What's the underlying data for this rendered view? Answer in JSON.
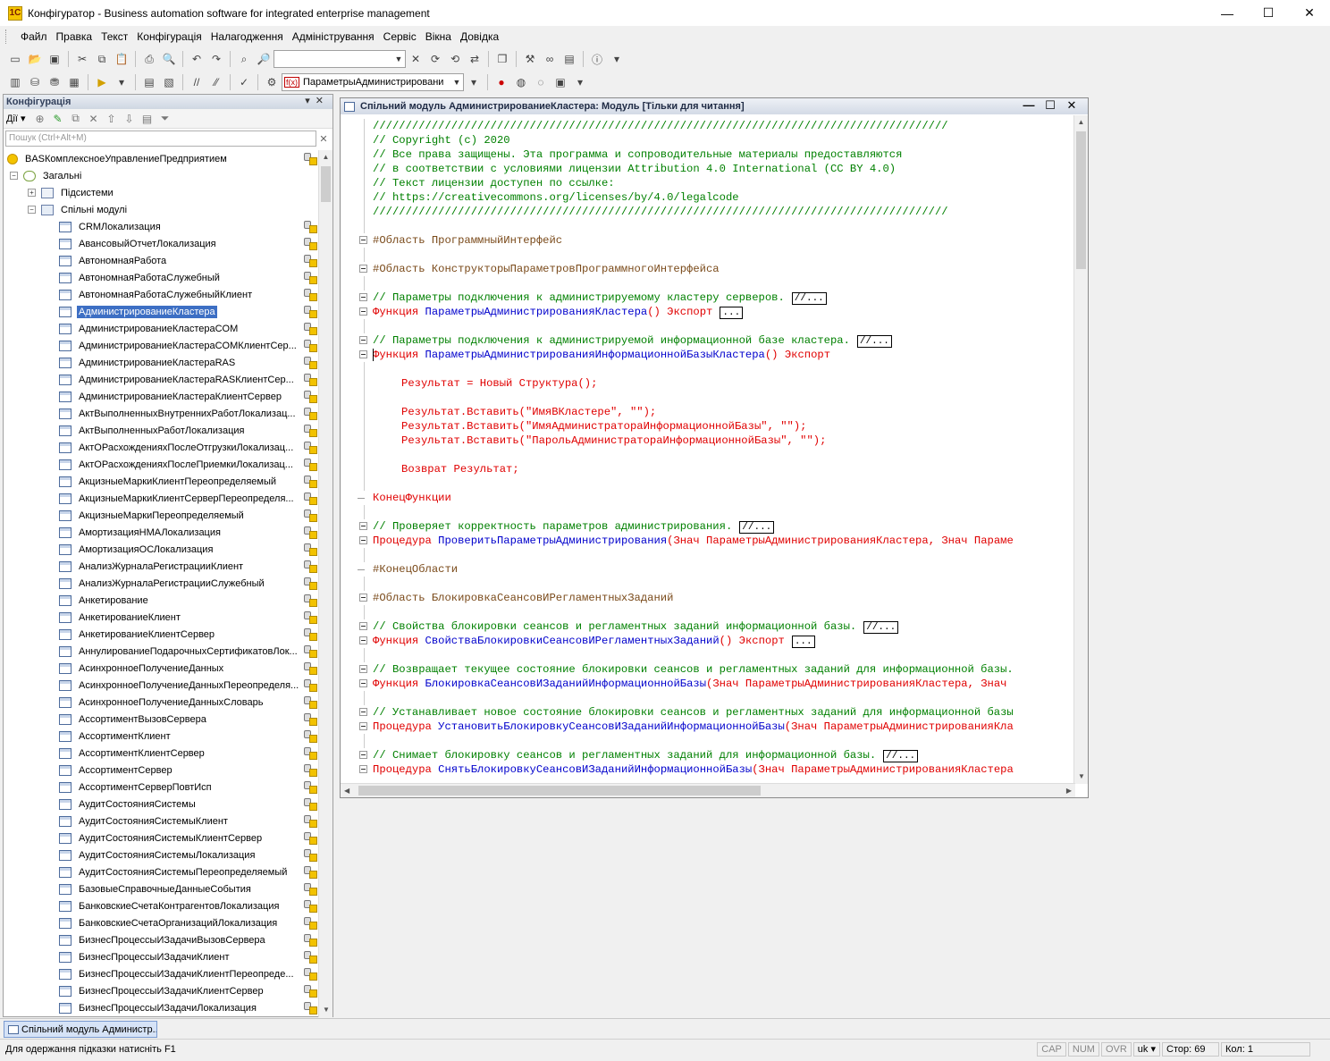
{
  "window": {
    "title": "Конфігуратор - Business automation software for integrated enterprise management",
    "app_icon": "1С",
    "minimize": "—",
    "maximize": "☐",
    "close": "✕"
  },
  "menu": [
    "Файл",
    "Правка",
    "Текст",
    "Конфігурація",
    "Налагодження",
    "Адміністрування",
    "Сервіс",
    "Вікна",
    "Довідка"
  ],
  "toolbar": {
    "search_value": "",
    "object_combo_value": "ПараметрыАдминистрировани",
    "object_combo_icon": "f(x)"
  },
  "config_panel": {
    "title": "Конфігурація",
    "actions_label": "Дії ▾",
    "search_placeholder": "Пошук (Ctrl+Alt+M)",
    "root": "BASКомплексноеУправлениеПредприятием",
    "general": "Загальні",
    "subsystems": "Підсистеми",
    "common_modules": "Спільні модулі",
    "selected_index": 5,
    "modules": [
      "CRMЛокализация",
      "АвансовыйОтчетЛокализация",
      "АвтономнаяРабота",
      "АвтономнаяРаботаСлужебный",
      "АвтономнаяРаботаСлужебныйКлиент",
      "АдминистрированиеКластера",
      "АдминистрированиеКластераCOM",
      "АдминистрированиеКластераCOMКлиентСер...",
      "АдминистрированиеКластераRAS",
      "АдминистрированиеКластераRASКлиентСер...",
      "АдминистрированиеКластераКлиентСервер",
      "АктВыполненныхВнутреннихРаботЛокализац...",
      "АктВыполненныхРаботЛокализация",
      "АктОРасхожденияхПослеОтгрузкиЛокализац...",
      "АктОРасхожденияхПослеПриемкиЛокализац...",
      "АкцизныеМаркиКлиентПереопределяемый",
      "АкцизныеМаркиКлиентСерверПереопределя...",
      "АкцизныеМаркиПереопределяемый",
      "АмортизацияНМАЛокализация",
      "АмортизацияОСЛокализация",
      "АнализЖурналаРегистрацииКлиент",
      "АнализЖурналаРегистрацииСлужебный",
      "Анкетирование",
      "АнкетированиеКлиент",
      "АнкетированиеКлиентСервер",
      "АннулированиеПодарочныхСертификатовЛок...",
      "АсинхронноеПолучениеДанных",
      "АсинхронноеПолучениеДанныхПереопределя...",
      "АсинхронноеПолучениеДанныхСловарь",
      "АссортиментВызовСервера",
      "АссортиментКлиент",
      "АссортиментКлиентСервер",
      "АссортиментСервер",
      "АссортиментСерверПовтИсп",
      "АудитСостоянияСистемы",
      "АудитСостоянияСистемыКлиент",
      "АудитСостоянияСистемыКлиентСервер",
      "АудитСостоянияСистемыЛокализация",
      "АудитСостоянияСистемыПереопределяемый",
      "БазовыеСправочныеДанныеСобытия",
      "БанковскиеСчетаКонтрагентовЛокализация",
      "БанковскиеСчетаОрганизацийЛокализация",
      "БизнесПроцессыИЗадачиВызовСервера",
      "БизнесПроцессыИЗадачиКлиент",
      "БизнесПроцессыИЗадачиКлиентПереопреде...",
      "БизнесПроцессыИЗадачиКлиентСервер",
      "БизнесПроцессыИЗадачиЛокализация"
    ]
  },
  "editor": {
    "title": "Спільний модуль АдминистрированиеКластера: Модуль [Тільки для читання]",
    "lines": [
      {
        "kind": "comment",
        "text": "////////////////////////////////////////////////////////////////////////////////////////"
      },
      {
        "kind": "comment",
        "text": "// Copyright (c) 2020"
      },
      {
        "kind": "comment",
        "text": "// Все права защищены. Эта программа и сопроводительные материалы предоставляются"
      },
      {
        "kind": "comment",
        "text": "// в соответствии с условиями лицензии Attribution 4.0 International (CC BY 4.0)"
      },
      {
        "kind": "comment",
        "text": "// Текст лицензии доступен по ссылке:"
      },
      {
        "kind": "comment",
        "text": "// https://creativecommons.org/licenses/by/4.0/legalcode"
      },
      {
        "kind": "comment",
        "text": "////////////////////////////////////////////////////////////////////////////////////////"
      },
      {
        "kind": "blank",
        "text": ""
      },
      {
        "kind": "region",
        "fold": true,
        "text": "#Область ПрограммныйИнтерфейс"
      },
      {
        "kind": "blank",
        "text": ""
      },
      {
        "kind": "region",
        "fold": true,
        "text": "#Область КонструкторыПараметровПрограммногоИнтерфейса"
      },
      {
        "kind": "blank",
        "text": ""
      },
      {
        "kind": "comment",
        "fold": true,
        "text": "// Параметры подключения к администрируемому кластеру серверов.",
        "box": "//..."
      },
      {
        "kind": "func",
        "fold": true,
        "kw": "Функция",
        "name": "ПараметрыАдминистрированияКластера",
        "rest": "()",
        "exp": "Экспорт",
        "box": "..."
      },
      {
        "kind": "blank",
        "text": ""
      },
      {
        "kind": "comment",
        "fold": true,
        "text": "// Параметры подключения к администрируемой информационной базе кластера.",
        "box": "//..."
      },
      {
        "kind": "func",
        "fold": true,
        "cursor": true,
        "kw": "Функция",
        "name": "ПараметрыАдминистрированияИнформационнойБазыКластера",
        "rest": "()",
        "exp": "Экспорт"
      },
      {
        "kind": "blank",
        "text": ""
      },
      {
        "kind": "code",
        "text": "Результат = Новый Структура();"
      },
      {
        "kind": "blank",
        "text": ""
      },
      {
        "kind": "code",
        "text": "Результат.Вставить(\"ИмяВКластере\", \"\");"
      },
      {
        "kind": "code",
        "text": "Результат.Вставить(\"ИмяАдминистратораИнформационнойБазы\", \"\");"
      },
      {
        "kind": "code",
        "text": "Результат.Вставить(\"ПарольАдминистратораИнформационнойБазы\", \"\");"
      },
      {
        "kind": "blank",
        "text": ""
      },
      {
        "kind": "code",
        "text": "Возврат Результат;"
      },
      {
        "kind": "blank",
        "text": ""
      },
      {
        "kind": "end",
        "text": "КонецФункции"
      },
      {
        "kind": "blank",
        "text": ""
      },
      {
        "kind": "comment",
        "fold": true,
        "text": "// Проверяет корректность параметров администрирования.",
        "box": "//..."
      },
      {
        "kind": "func",
        "fold": true,
        "kw": "Процедура",
        "name": "ПроверитьПараметрыАдминистрирования",
        "rest": "(Знач ПараметрыАдминистрированияКластера, Знач Параме"
      },
      {
        "kind": "blank",
        "text": ""
      },
      {
        "kind": "endregion",
        "text": "#КонецОбласти"
      },
      {
        "kind": "blank",
        "text": ""
      },
      {
        "kind": "region",
        "fold": true,
        "text": "#Область БлокировкаСеансовИРегламентныхЗаданий"
      },
      {
        "kind": "blank",
        "text": ""
      },
      {
        "kind": "comment",
        "fold": true,
        "text": "// Свойства блокировки сеансов и регламентных заданий информационной базы.",
        "box": "//..."
      },
      {
        "kind": "func",
        "fold": true,
        "kw": "Функция",
        "name": "СвойстваБлокировкиСеансовИРегламентныхЗаданий",
        "rest": "()",
        "exp": "Экспорт",
        "box": "..."
      },
      {
        "kind": "blank",
        "text": ""
      },
      {
        "kind": "comment",
        "fold": true,
        "text": "// Возвращает текущее состояние блокировки сеансов и регламентных заданий для информационной базы."
      },
      {
        "kind": "func",
        "fold": true,
        "kw": "Функция",
        "name": "БлокировкаСеансовИЗаданийИнформационнойБазы",
        "rest": "(Знач ПараметрыАдминистрированияКластера, Знач"
      },
      {
        "kind": "blank",
        "text": ""
      },
      {
        "kind": "comment",
        "fold": true,
        "text": "// Устанавливает новое состояние блокировки сеансов и регламентных заданий для информационной базы"
      },
      {
        "kind": "func",
        "fold": true,
        "kw": "Процедура",
        "name": "УстановитьБлокировкуСеансовИЗаданийИнформационнойБазы",
        "rest": "(Знач ПараметрыАдминистрированияКла"
      },
      {
        "kind": "blank",
        "text": ""
      },
      {
        "kind": "comment",
        "fold": true,
        "text": "// Снимает блокировку сеансов и регламентных заданий для информационной базы.",
        "box": "//..."
      },
      {
        "kind": "func",
        "fold": true,
        "kw": "Процедура",
        "name": "СнятьБлокировкуСеансовИЗаданийИнформационнойБазы",
        "rest": "(Знач ПараметрыАдминистрированияКластера"
      }
    ]
  },
  "window_tab": "Спільний модуль Администр...",
  "status": {
    "hint": "Для одержання підказки натисніть F1",
    "cap": "CAP",
    "num": "NUM",
    "ovr": "OVR",
    "lang": "uk ▾",
    "line": "Стор: 69",
    "col": "Кол: 1"
  },
  "colors": {
    "comment": "#008000",
    "keyword": "#e00000",
    "identifier": "#0000cc",
    "selection": "#3d6fc4"
  }
}
